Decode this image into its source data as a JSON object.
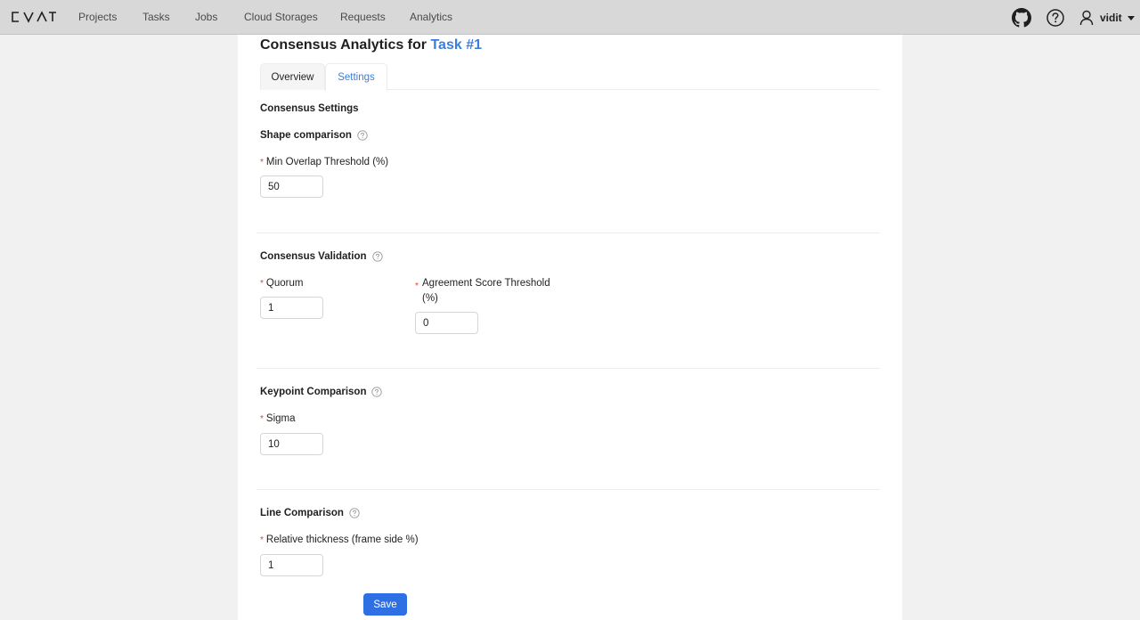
{
  "app": {
    "logo_text": "CVAT"
  },
  "nav": {
    "items": [
      "Projects",
      "Tasks",
      "Jobs",
      "Cloud Storages",
      "Requests",
      "Analytics"
    ]
  },
  "user": {
    "name": "vidit"
  },
  "page": {
    "title_prefix": "Consensus Analytics for",
    "task_link": "Task #1"
  },
  "tabs": {
    "overview": "Overview",
    "settings": "Settings",
    "active": "settings"
  },
  "settings": {
    "heading": "Consensus Settings",
    "shape": {
      "heading": "Shape comparison",
      "min_overlap_label": "Min Overlap Threshold (%)",
      "min_overlap_value": "50"
    },
    "validation": {
      "heading": "Consensus Validation",
      "quorum_label": "Quorum",
      "quorum_value": "1",
      "agreement_label": "Agreement Score Threshold (%)",
      "agreement_value": "0"
    },
    "keypoint": {
      "heading": "Keypoint Comparison",
      "sigma_label": "Sigma",
      "sigma_value": "10"
    },
    "line": {
      "heading": "Line Comparison",
      "thickness_label": "Relative thickness (frame side %)",
      "thickness_value": "1"
    },
    "save_label": "Save"
  },
  "colors": {
    "accent": "#2f6fe4",
    "link": "#3b7ddd",
    "required": "#e0463c",
    "header_bg": "#d8d8d8"
  },
  "icons": {
    "github": "github-icon",
    "help": "help-circle-icon",
    "user": "user-icon",
    "question": "question-circle-icon"
  }
}
